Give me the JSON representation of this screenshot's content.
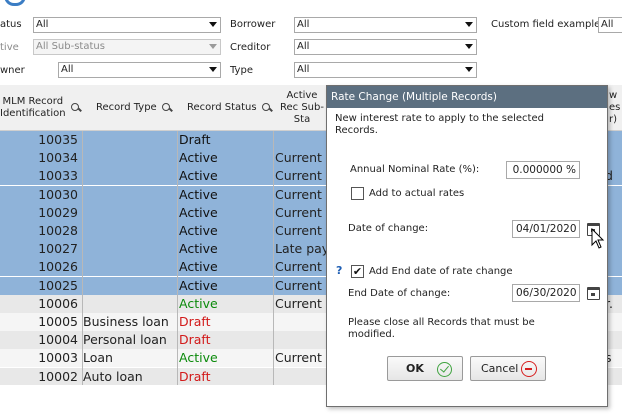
{
  "filters": {
    "status_label": "atus",
    "status_value": "All",
    "substatus_label": "tive",
    "substatus_value": "All Sub-status",
    "owner_label": "wner",
    "owner_value": "All",
    "borrower_label": "Borrower",
    "borrower_value": "All",
    "creditor_label": "Creditor",
    "creditor_value": "All",
    "type_label": "Type",
    "type_value": "All",
    "custom_label": "Custom field example",
    "custom_value": "All"
  },
  "grid": {
    "columns": {
      "mlm_id": "MLM Record Identification",
      "record_type": "Record Type",
      "record_status": "Record Status",
      "active_sub": "Active Rec Sub-Sta"
    },
    "rows": [
      {
        "id": "10035",
        "type": "",
        "status": "Draft",
        "sub": "",
        "selected": true
      },
      {
        "id": "10034",
        "type": "",
        "status": "Active",
        "sub": "Current",
        "selected": true
      },
      {
        "id": "10033",
        "type": "",
        "status": "Active",
        "sub": "Current",
        "selected": true
      },
      {
        "id": "10030",
        "type": "",
        "status": "Active",
        "sub": "Current",
        "selected": true
      },
      {
        "id": "10029",
        "type": "",
        "status": "Active",
        "sub": "Current",
        "selected": true
      },
      {
        "id": "10028",
        "type": "",
        "status": "Active",
        "sub": "Current",
        "selected": true
      },
      {
        "id": "10027",
        "type": "",
        "status": "Active",
        "sub": "Late pay",
        "selected": true
      },
      {
        "id": "10026",
        "type": "",
        "status": "Active",
        "sub": "Current",
        "selected": true
      },
      {
        "id": "10025",
        "type": "",
        "status": "Active",
        "sub": "Current",
        "selected": true
      },
      {
        "id": "10006",
        "type": "",
        "status": "Active",
        "sub": "Current",
        "selected": false
      },
      {
        "id": "10005",
        "type": "Business loan",
        "status": "Draft",
        "sub": "",
        "selected": false
      },
      {
        "id": "10004",
        "type": "Personal loan",
        "status": "Draft",
        "sub": "",
        "selected": false
      },
      {
        "id": "10003",
        "type": "Loan",
        "status": "Active",
        "sub": "Current",
        "selected": false
      },
      {
        "id": "10002",
        "type": "Auto loan",
        "status": "Draft",
        "sub": "",
        "selected": false
      }
    ],
    "right_edge": {
      "header": "w es r)",
      "row_10033": "d",
      "row_10006": "r.",
      "row_10003": "s"
    }
  },
  "dialog": {
    "title": "Rate Change (Multiple Records)",
    "intro": "New interest rate to apply to the selected Records.",
    "rate_label": "Annual Nominal Rate (%):",
    "rate_value": "0.000000 %",
    "add_actual_label": "Add to actual rates",
    "add_actual_checked": false,
    "date_label": "Date of change:",
    "date_value": "04/01/2020",
    "help_mark": "?",
    "end_date_check_label": "Add End date of rate change",
    "end_date_checked": true,
    "end_date_label": "End Date of change:",
    "end_date_value": "06/30/2020",
    "note": "Please close all Records that must be modified.",
    "ok_label": "OK",
    "cancel_label": "Cancel"
  }
}
